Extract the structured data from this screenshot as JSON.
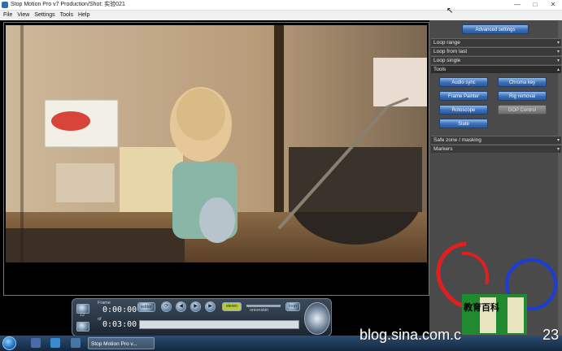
{
  "window": {
    "title": "Stop Motion Pro v7   Production/Shot: 实验021",
    "minimize_glyph": "—",
    "maximize_glyph": "□",
    "close_glyph": "✕"
  },
  "menu": [
    "File",
    "View",
    "Settings",
    "Tools",
    "Help"
  ],
  "panel": {
    "advanced_settings": "Advanced settings",
    "sections": {
      "loop_range": "Loop range",
      "loop_from_last": "Loop from last",
      "loop_single": "Loop single",
      "tools": "Tools",
      "safe_zone": "Safe zone / masking",
      "markers": "Markers"
    },
    "tools": {
      "audio_sync": "Audio sync",
      "chroma_key": "Chroma key",
      "frame_painter": "Frame Painter",
      "rig_removal": "Rig removal",
      "rotoscope": "Rotoscope",
      "dop_control": "DOP Control",
      "slate": "Slate"
    }
  },
  "controls": {
    "frame_label": "Frame",
    "frame_value": "0:00:00",
    "of_label": "of",
    "total_value": "0:03:00",
    "fps": "12",
    "editor_label": "editor",
    "loop_label": "loop",
    "stereo_label": "stereo",
    "onion_label": "onionskin"
  },
  "taskbar": {
    "task_label": "Stop Motion Pro v..."
  },
  "watermark": {
    "text": "blog.sina.com.c",
    "suffix": "23",
    "logo_text": "教育百科"
  },
  "colors": {
    "button_blue": "#3b6fb8",
    "panel_bg": "#4a4a4a",
    "logo_red": "#e02020",
    "logo_blue": "#1a3cd8",
    "logo_green": "#1f8a30"
  }
}
